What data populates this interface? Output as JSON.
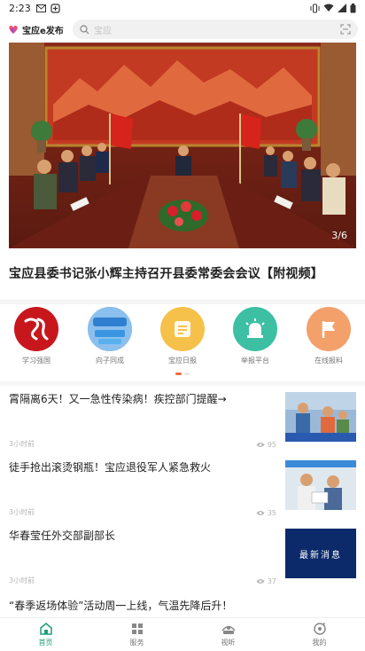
{
  "status_bar": {
    "time": "2:23",
    "left_icons": [
      "mail-icon",
      "app-icon"
    ],
    "right_icons": [
      "vibrate-icon",
      "wifi-icon",
      "signal-icon",
      "battery-icon"
    ]
  },
  "header": {
    "brand_name": "宝应e发布",
    "search_placeholder": "宝应"
  },
  "banner": {
    "page_indicator": "3/6",
    "headline": "宝应县委书记张小辉主持召开县委常委会会议【附视频】"
  },
  "quick_nav": {
    "items": [
      {
        "label": "学习强国",
        "icon": "xuexi-logo"
      },
      {
        "label": "向子同成",
        "icon": "cloud-logo"
      },
      {
        "label": "宝应日报",
        "icon": "newspaper-icon"
      },
      {
        "label": "举报平台",
        "icon": "alarm-icon"
      },
      {
        "label": "在线报料",
        "icon": "flag-icon"
      }
    ],
    "page_count": 2,
    "active_page": 1
  },
  "news": [
    {
      "title": "霄隔离6天！又一急性传染病！疾控部门提醒→",
      "time": "3小时前",
      "views": "95"
    },
    {
      "title": "徒手抢出滚烫钢瓶！宝应退役军人紧急救火",
      "time": "3小时前",
      "views": "35"
    },
    {
      "title": "华春莹任外交部副部长",
      "time": "3小时前",
      "views": "37"
    },
    {
      "title": "“春季返场体验”活动周一上线，气温先降后升！"
    }
  ],
  "thumb_text": {
    "news3": "最新消息"
  },
  "tab_bar": {
    "items": [
      {
        "label": "首页",
        "icon": "home-icon",
        "active": true
      },
      {
        "label": "服务",
        "icon": "grid-icon",
        "active": false
      },
      {
        "label": "视听",
        "icon": "media-icon",
        "active": false
      },
      {
        "label": "我的",
        "icon": "profile-icon",
        "active": false
      }
    ]
  },
  "colors": {
    "accent_green": "#1f9d7a",
    "dot_active": "#f26b3a",
    "xuexi_red": "#c8161d",
    "newspaper_yellow": "#f5c14a",
    "alarm_green": "#3dbfa3",
    "flag_orange": "#f3a06b"
  }
}
